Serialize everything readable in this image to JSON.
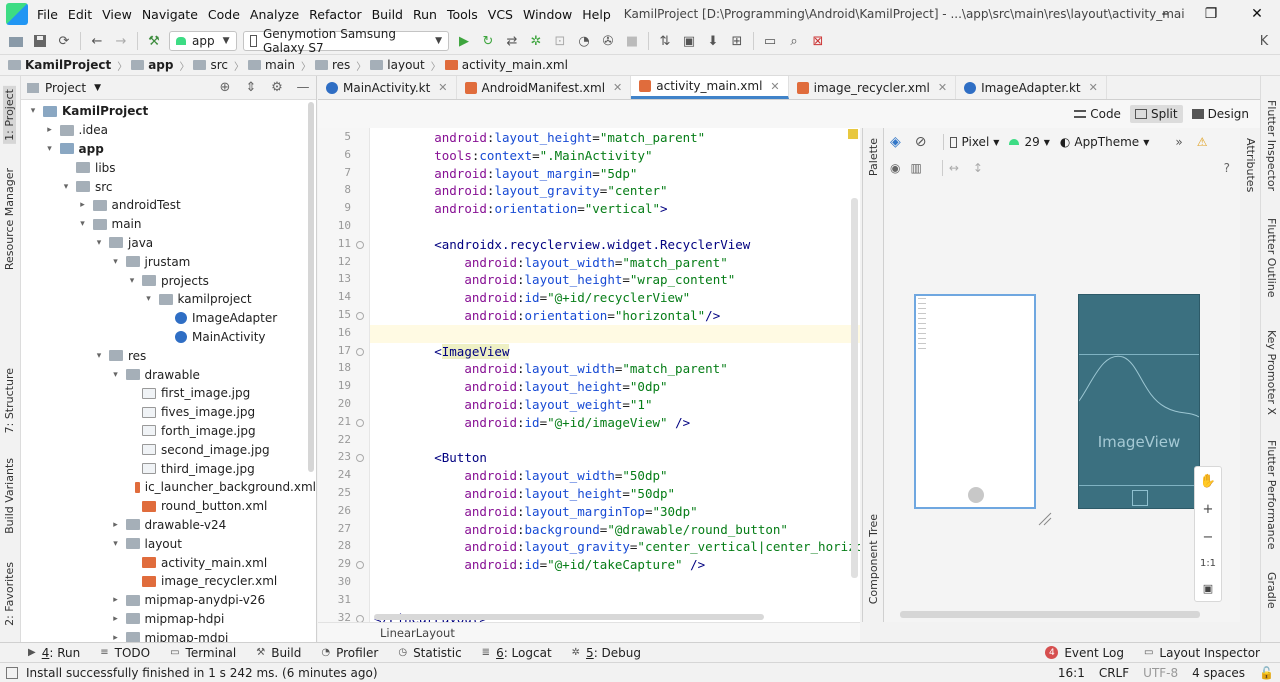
{
  "window": {
    "title": "KamilProject [D:\\Programming\\Android\\KamilProject] - ...\\app\\src\\main\\res\\layout\\activity_main.xml [app]",
    "minimize_glyph": "–",
    "maximize_glyph": "❐",
    "close_glyph": "✕"
  },
  "menu": [
    "File",
    "Edit",
    "View",
    "Navigate",
    "Code",
    "Analyze",
    "Refactor",
    "Build",
    "Run",
    "Tools",
    "VCS",
    "Window",
    "Help"
  ],
  "toolbar": {
    "module": "app",
    "device": "Genymotion Samsung Galaxy S7"
  },
  "breadcrumb": [
    "KamilProject",
    "app",
    "src",
    "main",
    "res",
    "layout",
    "activity_main.xml"
  ],
  "left_tools": [
    "1: Project",
    "Resource Manager",
    "7: Structure",
    "Build Variants",
    "2: Favorites"
  ],
  "right_tools": [
    "Flutter Inspector",
    "Flutter Outline",
    "Key Promoter X",
    "Flutter Performance",
    "Gradle"
  ],
  "attributes_label": "Attributes",
  "project_panel": {
    "title": "Project",
    "tree": [
      {
        "label": "KamilProject",
        "depth": 0,
        "arrow": "▾",
        "icon": "module",
        "bold": true
      },
      {
        "label": ".idea",
        "depth": 1,
        "arrow": "▸",
        "icon": "folder"
      },
      {
        "label": "app",
        "depth": 1,
        "arrow": "▾",
        "icon": "module",
        "bold": true
      },
      {
        "label": "libs",
        "depth": 2,
        "arrow": "",
        "icon": "folder"
      },
      {
        "label": "src",
        "depth": 2,
        "arrow": "▾",
        "icon": "folder"
      },
      {
        "label": "androidTest",
        "depth": 3,
        "arrow": "▸",
        "icon": "folder"
      },
      {
        "label": "main",
        "depth": 3,
        "arrow": "▾",
        "icon": "folder"
      },
      {
        "label": "java",
        "depth": 4,
        "arrow": "▾",
        "icon": "folder"
      },
      {
        "label": "jrustam",
        "depth": 5,
        "arrow": "▾",
        "icon": "folder"
      },
      {
        "label": "projects",
        "depth": 6,
        "arrow": "▾",
        "icon": "folder"
      },
      {
        "label": "kamilproject",
        "depth": 7,
        "arrow": "▾",
        "icon": "folder"
      },
      {
        "label": "ImageAdapter",
        "depth": 8,
        "arrow": "",
        "icon": "kt"
      },
      {
        "label": "MainActivity",
        "depth": 8,
        "arrow": "",
        "icon": "kt"
      },
      {
        "label": "res",
        "depth": 4,
        "arrow": "▾",
        "icon": "folder"
      },
      {
        "label": "drawable",
        "depth": 5,
        "arrow": "▾",
        "icon": "folder"
      },
      {
        "label": "first_image.jpg",
        "depth": 6,
        "arrow": "",
        "icon": "img"
      },
      {
        "label": "fives_image.jpg",
        "depth": 6,
        "arrow": "",
        "icon": "img"
      },
      {
        "label": "forth_image.jpg",
        "depth": 6,
        "arrow": "",
        "icon": "img"
      },
      {
        "label": "second_image.jpg",
        "depth": 6,
        "arrow": "",
        "icon": "img"
      },
      {
        "label": "third_image.jpg",
        "depth": 6,
        "arrow": "",
        "icon": "img"
      },
      {
        "label": "ic_launcher_background.xml",
        "depth": 6,
        "arrow": "",
        "icon": "xml"
      },
      {
        "label": "round_button.xml",
        "depth": 6,
        "arrow": "",
        "icon": "xml"
      },
      {
        "label": "drawable-v24",
        "depth": 5,
        "arrow": "▸",
        "icon": "folder"
      },
      {
        "label": "layout",
        "depth": 5,
        "arrow": "▾",
        "icon": "folder"
      },
      {
        "label": "activity_main.xml",
        "depth": 6,
        "arrow": "",
        "icon": "xml"
      },
      {
        "label": "image_recycler.xml",
        "depth": 6,
        "arrow": "",
        "icon": "xml"
      },
      {
        "label": "mipmap-anydpi-v26",
        "depth": 5,
        "arrow": "▸",
        "icon": "folder"
      },
      {
        "label": "mipmap-hdpi",
        "depth": 5,
        "arrow": "▸",
        "icon": "folder"
      },
      {
        "label": "mipmap-mdpi",
        "depth": 5,
        "arrow": "▸",
        "icon": "folder"
      }
    ]
  },
  "tabs": [
    {
      "label": "MainActivity.kt",
      "kind": "kt",
      "active": false
    },
    {
      "label": "AndroidManifest.xml",
      "kind": "xml",
      "active": false
    },
    {
      "label": "activity_main.xml",
      "kind": "xml",
      "active": true
    },
    {
      "label": "image_recycler.xml",
      "kind": "xml",
      "active": false
    },
    {
      "label": "ImageAdapter.kt",
      "kind": "kt",
      "active": false
    }
  ],
  "view_modes": {
    "code": "Code",
    "split": "Split",
    "design": "Design"
  },
  "editor": {
    "current_line": 16,
    "lines": [
      {
        "n": "5",
        "parts": [
          [
            "ind",
            "        "
          ],
          [
            "ns",
            "android"
          ],
          [
            "plain",
            ":"
          ],
          [
            "attr",
            "layout_height"
          ],
          [
            "plain",
            "="
          ],
          [
            "val",
            "\"match_parent\""
          ]
        ]
      },
      {
        "n": "6",
        "parts": [
          [
            "ind",
            "        "
          ],
          [
            "ns",
            "tools"
          ],
          [
            "plain",
            ":"
          ],
          [
            "attr",
            "context"
          ],
          [
            "plain",
            "="
          ],
          [
            "val",
            "\".MainActivity\""
          ]
        ]
      },
      {
        "n": "7",
        "parts": [
          [
            "ind",
            "        "
          ],
          [
            "ns",
            "android"
          ],
          [
            "plain",
            ":"
          ],
          [
            "attr",
            "layout_margin"
          ],
          [
            "plain",
            "="
          ],
          [
            "val",
            "\"5dp\""
          ]
        ]
      },
      {
        "n": "8",
        "parts": [
          [
            "ind",
            "        "
          ],
          [
            "ns",
            "android"
          ],
          [
            "plain",
            ":"
          ],
          [
            "attr",
            "layout_gravity"
          ],
          [
            "plain",
            "="
          ],
          [
            "val",
            "\"center\""
          ]
        ]
      },
      {
        "n": "9",
        "parts": [
          [
            "ind",
            "        "
          ],
          [
            "ns",
            "android"
          ],
          [
            "plain",
            ":"
          ],
          [
            "attr",
            "orientation"
          ],
          [
            "plain",
            "="
          ],
          [
            "val",
            "\"vertical\""
          ],
          [
            "tag",
            ">"
          ]
        ]
      },
      {
        "n": "10",
        "parts": []
      },
      {
        "n": "11",
        "parts": [
          [
            "ind",
            "        "
          ],
          [
            "tag",
            "<androidx.recyclerview.widget.RecyclerView"
          ]
        ]
      },
      {
        "n": "12",
        "parts": [
          [
            "ind",
            "            "
          ],
          [
            "ns",
            "android"
          ],
          [
            "plain",
            ":"
          ],
          [
            "attr",
            "layout_width"
          ],
          [
            "plain",
            "="
          ],
          [
            "val",
            "\"match_parent\""
          ]
        ]
      },
      {
        "n": "13",
        "parts": [
          [
            "ind",
            "            "
          ],
          [
            "ns",
            "android"
          ],
          [
            "plain",
            ":"
          ],
          [
            "attr",
            "layout_height"
          ],
          [
            "plain",
            "="
          ],
          [
            "val",
            "\"wrap_content\""
          ]
        ]
      },
      {
        "n": "14",
        "parts": [
          [
            "ind",
            "            "
          ],
          [
            "ns",
            "android"
          ],
          [
            "plain",
            ":"
          ],
          [
            "attr",
            "id"
          ],
          [
            "plain",
            "="
          ],
          [
            "val",
            "\"@+id/recyclerView\""
          ]
        ]
      },
      {
        "n": "15",
        "parts": [
          [
            "ind",
            "            "
          ],
          [
            "ns",
            "android"
          ],
          [
            "plain",
            ":"
          ],
          [
            "attr",
            "orientation"
          ],
          [
            "plain",
            "="
          ],
          [
            "val",
            "\"horizontal\""
          ],
          [
            "tag",
            "/>"
          ]
        ]
      },
      {
        "n": "16",
        "parts": []
      },
      {
        "n": "17",
        "parts": [
          [
            "ind",
            "        "
          ],
          [
            "tag",
            "<"
          ],
          [
            "tagh",
            "ImageView"
          ]
        ]
      },
      {
        "n": "18",
        "parts": [
          [
            "ind",
            "            "
          ],
          [
            "ns",
            "android"
          ],
          [
            "plain",
            ":"
          ],
          [
            "attr",
            "layout_width"
          ],
          [
            "plain",
            "="
          ],
          [
            "val",
            "\"match_parent\""
          ]
        ]
      },
      {
        "n": "19",
        "parts": [
          [
            "ind",
            "            "
          ],
          [
            "ns",
            "android"
          ],
          [
            "plain",
            ":"
          ],
          [
            "attr",
            "layout_height"
          ],
          [
            "plain",
            "="
          ],
          [
            "val",
            "\"0dp\""
          ]
        ]
      },
      {
        "n": "20",
        "parts": [
          [
            "ind",
            "            "
          ],
          [
            "ns",
            "android"
          ],
          [
            "plain",
            ":"
          ],
          [
            "attr",
            "layout_weight"
          ],
          [
            "plain",
            "="
          ],
          [
            "val",
            "\"1\""
          ]
        ]
      },
      {
        "n": "21",
        "parts": [
          [
            "ind",
            "            "
          ],
          [
            "ns",
            "android"
          ],
          [
            "plain",
            ":"
          ],
          [
            "attr",
            "id"
          ],
          [
            "plain",
            "="
          ],
          [
            "val",
            "\"@+id/imageView\""
          ],
          [
            "tag",
            " />"
          ]
        ]
      },
      {
        "n": "22",
        "parts": []
      },
      {
        "n": "23",
        "parts": [
          [
            "ind",
            "        "
          ],
          [
            "tag",
            "<Button"
          ]
        ]
      },
      {
        "n": "24",
        "parts": [
          [
            "ind",
            "            "
          ],
          [
            "ns",
            "android"
          ],
          [
            "plain",
            ":"
          ],
          [
            "attr",
            "layout_width"
          ],
          [
            "plain",
            "="
          ],
          [
            "val",
            "\"50dp\""
          ]
        ]
      },
      {
        "n": "25",
        "parts": [
          [
            "ind",
            "            "
          ],
          [
            "ns",
            "android"
          ],
          [
            "plain",
            ":"
          ],
          [
            "attr",
            "layout_height"
          ],
          [
            "plain",
            "="
          ],
          [
            "val",
            "\"50dp\""
          ]
        ]
      },
      {
        "n": "26",
        "parts": [
          [
            "ind",
            "            "
          ],
          [
            "ns",
            "android"
          ],
          [
            "plain",
            ":"
          ],
          [
            "attr",
            "layout_marginTop"
          ],
          [
            "plain",
            "="
          ],
          [
            "val",
            "\"30dp\""
          ]
        ]
      },
      {
        "n": "27",
        "parts": [
          [
            "ind",
            "            "
          ],
          [
            "ns",
            "android"
          ],
          [
            "plain",
            ":"
          ],
          [
            "attr",
            "background"
          ],
          [
            "plain",
            "="
          ],
          [
            "val",
            "\"@drawable/round_button\""
          ]
        ]
      },
      {
        "n": "28",
        "parts": [
          [
            "ind",
            "            "
          ],
          [
            "ns",
            "android"
          ],
          [
            "plain",
            ":"
          ],
          [
            "attr",
            "layout_gravity"
          ],
          [
            "plain",
            "="
          ],
          [
            "val",
            "\"center_vertical|center_horizontal"
          ]
        ]
      },
      {
        "n": "29",
        "parts": [
          [
            "ind",
            "            "
          ],
          [
            "ns",
            "android"
          ],
          [
            "plain",
            ":"
          ],
          [
            "attr",
            "id"
          ],
          [
            "plain",
            "="
          ],
          [
            "val",
            "\"@+id/takeCapture\""
          ],
          [
            "tag",
            " />"
          ]
        ]
      },
      {
        "n": "30",
        "parts": []
      },
      {
        "n": "31",
        "parts": []
      },
      {
        "n": "32",
        "parts": [
          [
            "tag",
            "</LinearLayout>"
          ]
        ]
      }
    ],
    "structure_crumb": "LinearLayout"
  },
  "palette_label": "Palette",
  "component_tree_label": "Component Tree",
  "design": {
    "device": "Pixel",
    "api": "29",
    "theme": "AppTheme",
    "image_view_label": "ImageView",
    "zoom_ratio": "1:1"
  },
  "bottom_tools": [
    {
      "key": "4",
      "label": ": Run",
      "glyph": "▶"
    },
    {
      "key": "",
      "label": "TODO",
      "glyph": "≡"
    },
    {
      "key": "",
      "label": "Terminal",
      "glyph": "▭"
    },
    {
      "key": "",
      "label": "Build",
      "glyph": "⚒"
    },
    {
      "key": "",
      "label": "Profiler",
      "glyph": "◔"
    },
    {
      "key": "",
      "label": "Statistic",
      "glyph": "◷"
    },
    {
      "key": "6",
      "label": ": Logcat",
      "glyph": "≣"
    },
    {
      "key": "5",
      "label": ": Debug",
      "glyph": "✲"
    }
  ],
  "event_log": "Event Log",
  "layout_inspector": "Layout Inspector",
  "event_log_count": "4",
  "status": {
    "message": "Install successfully finished in 1 s 242 ms. (6 minutes ago)",
    "position": "16:1",
    "line_sep": "CRLF",
    "encoding": "UTF-8",
    "indent": "4 spaces"
  },
  "colors": {
    "accent": "#4083c9",
    "android_green": "#3ddc84",
    "preview_bg": "#3b7080",
    "warning": "#e8c840"
  }
}
